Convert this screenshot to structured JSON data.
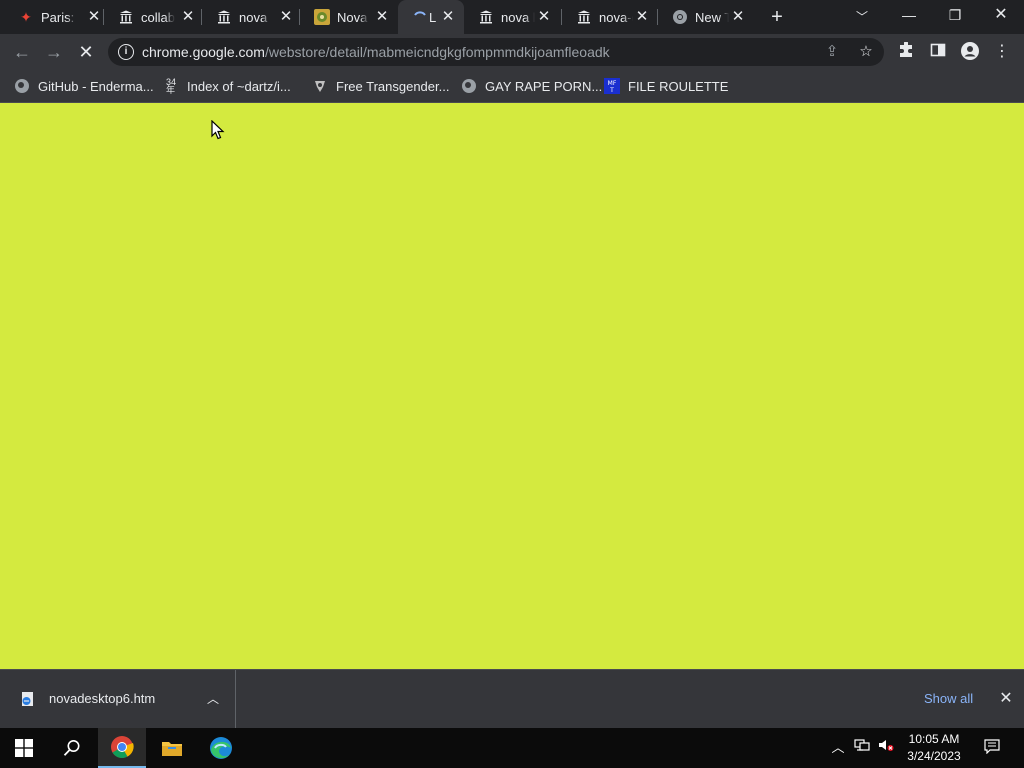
{
  "tabs": [
    {
      "title": "Paris: Intern",
      "favicon": "sparkle-icon",
      "active": false
    },
    {
      "title": "collab",
      "favicon": "pillars-icon",
      "active": false
    },
    {
      "title": "nova l",
      "favicon": "pillars-icon",
      "active": false
    },
    {
      "title": "Nova",
      "favicon": "game-icon",
      "active": false
    },
    {
      "title": "L",
      "favicon": "loading-icon",
      "active": true
    },
    {
      "title": "nova l",
      "favicon": "pillars-icon",
      "active": false
    },
    {
      "title": "nova-d",
      "favicon": "pillars-icon",
      "active": false
    },
    {
      "title": "New Tab",
      "favicon": "chrome-icon",
      "active": false
    }
  ],
  "address_bar": {
    "host": "chrome.google.com",
    "path": "/webstore/detail/mabmeicndgkgfompmmdkijoamfleoadk"
  },
  "bookmarks": [
    {
      "label": "GitHub - Enderma...",
      "icon": "globe-icon"
    },
    {
      "label": "Index of ~dartz/i...",
      "icon": "index-icon"
    },
    {
      "label": "Free Transgender...",
      "icon": "site-icon"
    },
    {
      "label": "GAY RAPE PORN...",
      "icon": "globe-icon"
    },
    {
      "label": "FILE ROULETTE",
      "icon": "file-roulette-icon"
    }
  ],
  "content": {
    "background_color": "#d4ea3f"
  },
  "downloads": {
    "file_name": "novadesktop6.htm",
    "show_all_label": "Show all"
  },
  "taskbar": {
    "time": "10:05 AM",
    "date": "3/24/2023"
  },
  "colors": {
    "tabstrip": "#202124",
    "toolbar": "#35363a",
    "link": "#8ab4f8",
    "page": "#d4ea3f"
  }
}
